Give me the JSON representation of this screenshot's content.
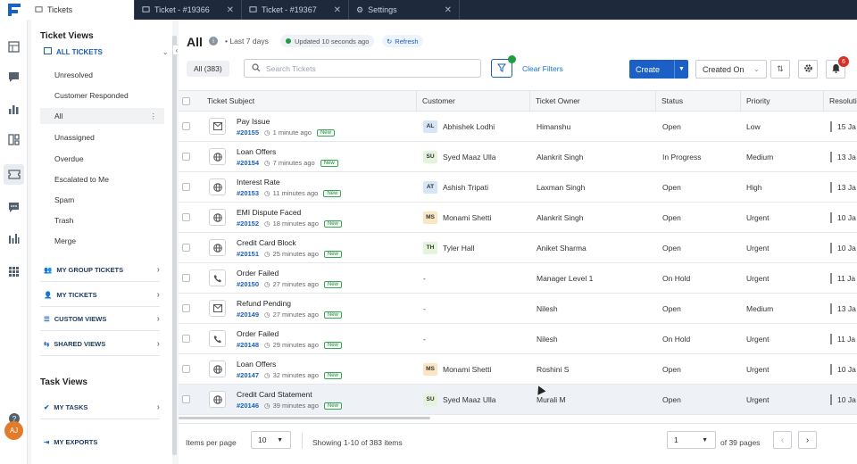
{
  "tabs": [
    {
      "label": "Tickets",
      "active": true
    },
    {
      "label": "Ticket - #19366",
      "active": false
    },
    {
      "label": "Ticket - #19367",
      "active": false
    },
    {
      "label": "Settings",
      "active": false
    }
  ],
  "user": {
    "initials": "AJ"
  },
  "sidebar": {
    "ticket_views_title": "Ticket Views",
    "all_tickets": "ALL TICKETS",
    "items": [
      "Unresolved",
      "Customer Responded",
      "All",
      "Unassigned",
      "Overdue",
      "Escalated to Me",
      "Spam",
      "Trash",
      "Merge"
    ],
    "active_item": "All",
    "groups": [
      "MY GROUP TICKETS",
      "MY TICKETS",
      "CUSTOM VIEWS",
      "SHARED VIEWS"
    ],
    "task_views_title": "Task Views",
    "my_tasks": "MY TASKS",
    "my_exports": "MY EXPORTS"
  },
  "header": {
    "title": "All",
    "range": "Last 7 days",
    "updated": "Updated 10 seconds ago",
    "refresh": "Refresh"
  },
  "toolbar": {
    "count_pill": "All (383)",
    "search_placeholder": "Search Tickets",
    "clear_filters": "Clear Filters",
    "create_label": "Create",
    "sort_label": "Created On",
    "notif_count": "6"
  },
  "table": {
    "columns": [
      "Ticket Subject",
      "Customer",
      "Ticket Owner",
      "Status",
      "Priority",
      "Resoluti"
    ],
    "rows": [
      {
        "icon": "mail",
        "subject": "Pay Issue",
        "id": "#20155",
        "ago": "1 minute ago",
        "new": "New",
        "initials": "AL",
        "customer": "Abhishek Lodhi",
        "owner": "Himanshu",
        "status": "Open",
        "priority": "Low",
        "resolution": "15 Ja"
      },
      {
        "icon": "globe",
        "subject": "Loan Offers",
        "id": "#20154",
        "ago": "7 minutes ago",
        "new": "New",
        "initials": "SU",
        "customer": "Syed Maaz Ulla",
        "owner": "Alankrit Singh",
        "status": "In Progress",
        "priority": "Medium",
        "resolution": "13 Ja"
      },
      {
        "icon": "globe",
        "subject": "Interest Rate",
        "id": "#20153",
        "ago": "11 minutes ago",
        "new": "New",
        "initials": "AT",
        "customer": "Ashish Tripati",
        "owner": "Laxman Singh",
        "status": "Open",
        "priority": "High",
        "resolution": "13 Ja"
      },
      {
        "icon": "globe",
        "subject": "EMI Dispute Faced",
        "id": "#20152",
        "ago": "18 minutes ago",
        "new": "New",
        "initials": "MS",
        "customer": "Monami Shetti",
        "owner": "Alankrit Singh",
        "status": "Open",
        "priority": "Urgent",
        "resolution": "10 Ja"
      },
      {
        "icon": "globe",
        "subject": "Credit Card Block",
        "id": "#20151",
        "ago": "25 minutes ago",
        "new": "New",
        "initials": "TH",
        "customer": "Tyler Hall",
        "owner": "Aniket Sharma",
        "status": "Open",
        "priority": "Urgent",
        "resolution": "10 Ja"
      },
      {
        "icon": "phone",
        "subject": "Order Failed",
        "id": "#20150",
        "ago": "27 minutes ago",
        "new": "New",
        "initials": "",
        "customer": "-",
        "owner": "Manager Level 1",
        "status": "On Hold",
        "priority": "Urgent",
        "resolution": "11 Ja"
      },
      {
        "icon": "mail",
        "subject": "Refund Pending",
        "id": "#20149",
        "ago": "27 minutes ago",
        "new": "New",
        "initials": "",
        "customer": "-",
        "owner": "Nilesh",
        "status": "Open",
        "priority": "Medium",
        "resolution": "13 Ja"
      },
      {
        "icon": "phone",
        "subject": "Order Failed",
        "id": "#20148",
        "ago": "29 minutes ago",
        "new": "New",
        "initials": "",
        "customer": "-",
        "owner": "Nilesh",
        "status": "On Hold",
        "priority": "Urgent",
        "resolution": "11 Ja"
      },
      {
        "icon": "globe",
        "subject": "Loan Offers",
        "id": "#20147",
        "ago": "32 minutes ago",
        "new": "New",
        "initials": "MS",
        "customer": "Monami Shetti",
        "owner": "Roshini S",
        "status": "Open",
        "priority": "Urgent",
        "resolution": "10 Ja"
      },
      {
        "icon": "globe",
        "subject": "Credit Card Statement",
        "id": "#20146",
        "ago": "39 minutes ago",
        "new": "New",
        "initials": "SU",
        "customer": "Syed Maaz Ulla",
        "owner": "Murali M",
        "status": "Open",
        "priority": "Urgent",
        "resolution": "10 Ja"
      }
    ]
  },
  "footer": {
    "items_per_page_label": "Items per page",
    "items_per_page": "10",
    "showing": "Showing 1-10 of 383 items",
    "page": "1",
    "of_pages": "of 39 pages"
  },
  "colors": {
    "accent": "#1c5fc6",
    "new_badge": "#3aa757",
    "tabbar": "#1e2a3b",
    "notif": "#d93025"
  }
}
